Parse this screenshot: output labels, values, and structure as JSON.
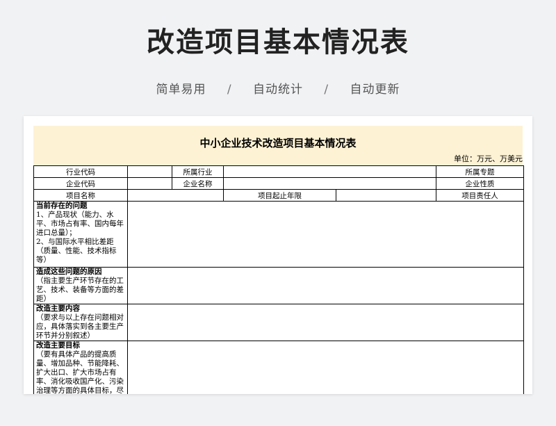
{
  "page": {
    "title": "改造项目基本情况表",
    "tags": [
      "简单易用",
      "自动统计",
      "自动更新"
    ],
    "separator": "/"
  },
  "sheet": {
    "title": "中小企业技术改造项目基本情况表",
    "unit": "单位：万元、万美元",
    "info_rows": [
      {
        "label1": "行业代码",
        "label2": "所属行业",
        "label3": "所属专题"
      },
      {
        "label1": "企业代码",
        "label2": "企业名称",
        "label3": "企业性质"
      },
      {
        "label1": "项目名称",
        "label2": "项目起止年限",
        "label3": "项目责任人"
      }
    ],
    "sections": [
      {
        "title": "当前存在的问题",
        "desc": "1、产品现状（能力、水平、市场占有率、国内每年进口总量）；\n2、与国际水平相比差距（质量、性能、技术指标等）"
      },
      {
        "title": "造成这些问题的原因",
        "desc": "（指主要生产环节存在的工艺、技术、装备等方面的差距）"
      },
      {
        "title": "改造主要内容",
        "desc": "（要求与以上存在问题相对应，具体落实到各主要生产环节并分别叙述）"
      },
      {
        "title": "改造主要目标",
        "desc": "（要有具体产品的提高质量、增加品种、节能降耗、扩大出口、扩大市场占有率、消化吸收国产化、污染治理等方面的具体目标，尽量用数据表示）"
      }
    ]
  }
}
